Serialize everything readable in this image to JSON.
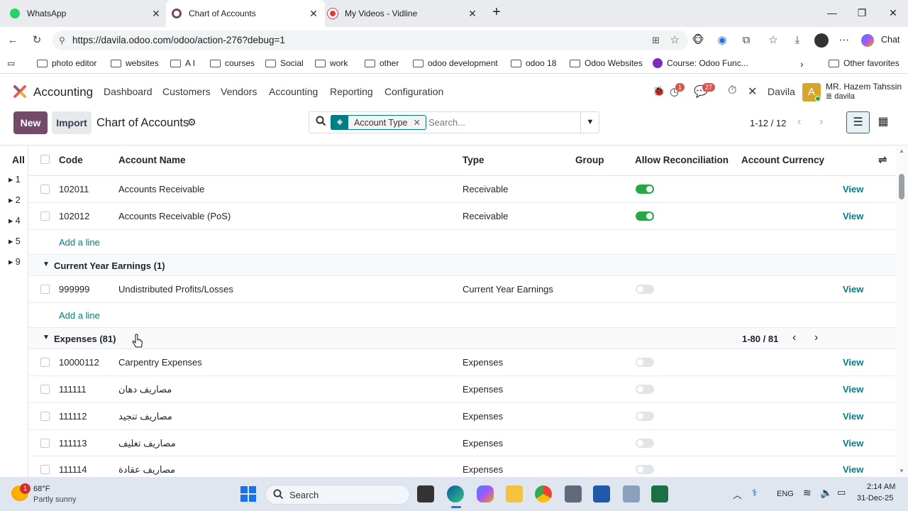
{
  "browser": {
    "tabs": [
      {
        "label": "WhatsApp"
      },
      {
        "label": "Chart of Accounts"
      },
      {
        "label": "My Videos - Vidline"
      }
    ],
    "url": "https://davila.odoo.com/odoo/action-276?debug=1",
    "chat_label": "Chat",
    "bookmarks": [
      "photo editor",
      "websites",
      "A I",
      "courses",
      "Social",
      "work",
      "other",
      "odoo development",
      "odoo 18",
      "Odoo Websites",
      "Course: Odoo Func..."
    ],
    "other_favorites": "Other favorites"
  },
  "navbar": {
    "app": "Accounting",
    "menu": [
      "Dashboard",
      "Customers",
      "Vendors",
      "Accounting",
      "Reporting",
      "Configuration"
    ],
    "activity_count": "1",
    "messages_count": "27",
    "company": "Davila",
    "user_name": "MR. Hazem Tahssin",
    "user_db": "davila",
    "avatar_letter": "A"
  },
  "control": {
    "new_label": "New",
    "import_label": "Import",
    "title": "Chart of Accounts",
    "facet": "Account Type",
    "search_placeholder": "Search...",
    "pager": "1-12 / 12"
  },
  "list": {
    "headers": {
      "all": "All",
      "code": "Code",
      "name": "Account Name",
      "type": "Type",
      "group": "Group",
      "reconcile": "Allow Reconciliation",
      "currency": "Account Currency"
    },
    "left_groups": [
      "1",
      "2",
      "4",
      "5",
      "9"
    ],
    "add_line": "Add a line",
    "view_label": "View",
    "rows": [
      {
        "code": "102011",
        "name": "Accounts Receivable",
        "type": "Receivable",
        "reconcile": true
      },
      {
        "code": "102012",
        "name": "Accounts Receivable (PoS)",
        "type": "Receivable",
        "reconcile": true
      }
    ],
    "group_current": {
      "label": "Current Year Earnings (1)"
    },
    "current_rows": [
      {
        "code": "999999",
        "name": "Undistributed Profits/Losses",
        "type": "Current Year Earnings",
        "reconcile": false
      }
    ],
    "group_expenses": {
      "label": "Expenses (81)",
      "pager": "1-80 / 81"
    },
    "expense_rows": [
      {
        "code": "10000112",
        "name": "Carpentry Expenses",
        "type": "Expenses",
        "reconcile": false
      },
      {
        "code": "111111",
        "name": "مصاريف دهان",
        "type": "Expenses",
        "reconcile": false
      },
      {
        "code": "111112",
        "name": "مصاريف تنجيد",
        "type": "Expenses",
        "reconcile": false
      },
      {
        "code": "111113",
        "name": "مصاريف تغليف",
        "type": "Expenses",
        "reconcile": false
      },
      {
        "code": "111114",
        "name": "مصاريف عقادة",
        "type": "Expenses",
        "reconcile": false
      }
    ]
  },
  "taskbar": {
    "weather_temp": "68°F",
    "weather_desc": "Partly sunny",
    "weather_badge": "1",
    "search_label": "Search",
    "lang": "ENG",
    "time": "2:14 AM",
    "date": "31-Dec-25"
  }
}
